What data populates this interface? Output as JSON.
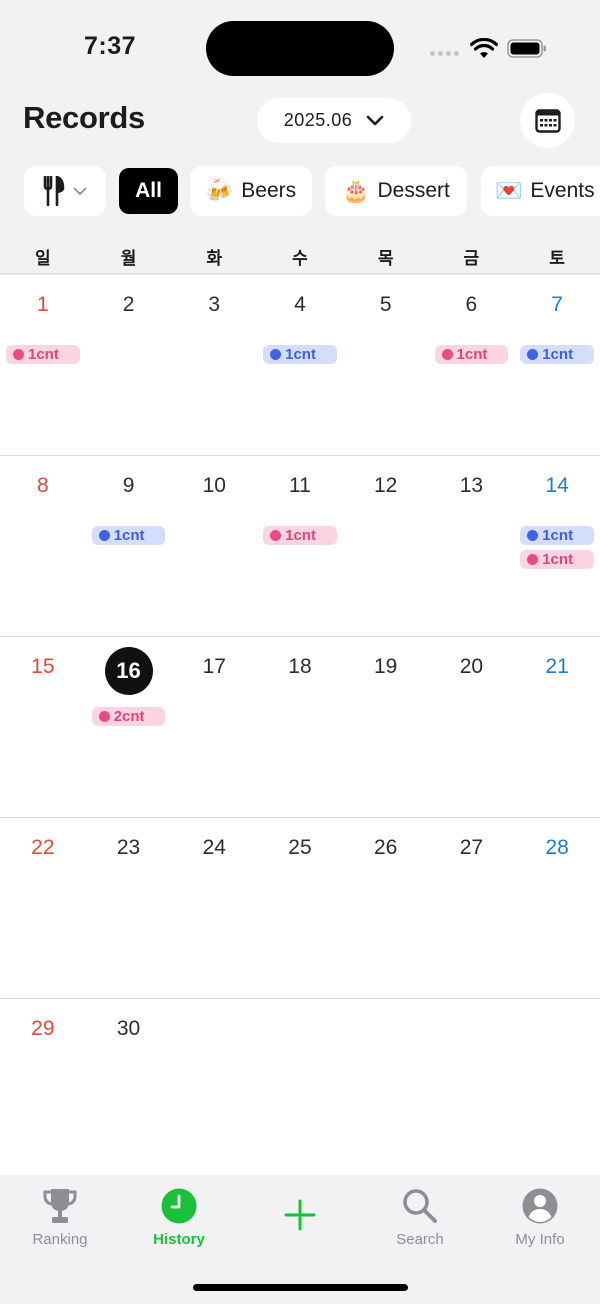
{
  "status_bar": {
    "time": "7:37"
  },
  "header": {
    "title": "Records",
    "month": "2025.06"
  },
  "filters": {
    "items": [
      {
        "emoji": "",
        "label": "All"
      },
      {
        "emoji": "🍻",
        "label": "Beers"
      },
      {
        "emoji": "🎂",
        "label": "Dessert"
      },
      {
        "emoji": "💌",
        "label": "Events"
      }
    ]
  },
  "weekdays": [
    "일",
    "월",
    "화",
    "수",
    "목",
    "금",
    "토"
  ],
  "calendar": {
    "weeks": [
      {
        "days": [
          {
            "n": "1",
            "badges": [
              {
                "text": "1cnt",
                "color": "pink"
              }
            ]
          },
          {
            "n": "2",
            "badges": []
          },
          {
            "n": "3",
            "badges": []
          },
          {
            "n": "4",
            "badges": [
              {
                "text": "1cnt",
                "color": "blue"
              }
            ]
          },
          {
            "n": "5",
            "badges": []
          },
          {
            "n": "6",
            "badges": [
              {
                "text": "1cnt",
                "color": "pink"
              }
            ]
          },
          {
            "n": "7",
            "badges": [
              {
                "text": "1cnt",
                "color": "blue"
              }
            ]
          }
        ]
      },
      {
        "days": [
          {
            "n": "8",
            "badges": []
          },
          {
            "n": "9",
            "badges": [
              {
                "text": "1cnt",
                "color": "blue"
              }
            ]
          },
          {
            "n": "10",
            "badges": []
          },
          {
            "n": "11",
            "badges": [
              {
                "text": "1cnt",
                "color": "pink"
              }
            ]
          },
          {
            "n": "12",
            "badges": []
          },
          {
            "n": "13",
            "badges": []
          },
          {
            "n": "14",
            "badges": [
              {
                "text": "1cnt",
                "color": "blue"
              },
              {
                "text": "1cnt",
                "color": "pink"
              }
            ]
          }
        ]
      },
      {
        "days": [
          {
            "n": "15",
            "badges": []
          },
          {
            "n": "16",
            "today": true,
            "badges": [
              {
                "text": "2cnt",
                "color": "pink"
              }
            ]
          },
          {
            "n": "17",
            "badges": []
          },
          {
            "n": "18",
            "badges": []
          },
          {
            "n": "19",
            "badges": []
          },
          {
            "n": "20",
            "badges": []
          },
          {
            "n": "21",
            "badges": []
          }
        ]
      },
      {
        "days": [
          {
            "n": "22",
            "badges": []
          },
          {
            "n": "23",
            "badges": []
          },
          {
            "n": "24",
            "badges": []
          },
          {
            "n": "25",
            "badges": []
          },
          {
            "n": "26",
            "badges": []
          },
          {
            "n": "27",
            "badges": []
          },
          {
            "n": "28",
            "badges": []
          }
        ]
      },
      {
        "days": [
          {
            "n": "29",
            "badges": []
          },
          {
            "n": "30",
            "badges": []
          },
          {
            "n": "",
            "badges": []
          },
          {
            "n": "",
            "badges": []
          },
          {
            "n": "",
            "badges": []
          },
          {
            "n": "",
            "badges": []
          },
          {
            "n": "",
            "badges": []
          }
        ]
      }
    ]
  },
  "bottom_nav": {
    "items": [
      {
        "label": "Ranking",
        "icon": "trophy-icon"
      },
      {
        "label": "History",
        "icon": "clock-icon",
        "active": true
      },
      {
        "label": "",
        "icon": "plus-icon"
      },
      {
        "label": "Search",
        "icon": "search-icon"
      },
      {
        "label": "My Info",
        "icon": "person-icon"
      }
    ]
  },
  "colors": {
    "accent_green": "#19c138",
    "sunday_red": "#e5473c",
    "saturday_blue": "#1f7bd0",
    "badge_pink": "#ec4a82",
    "badge_blue": "#3e63e6"
  }
}
